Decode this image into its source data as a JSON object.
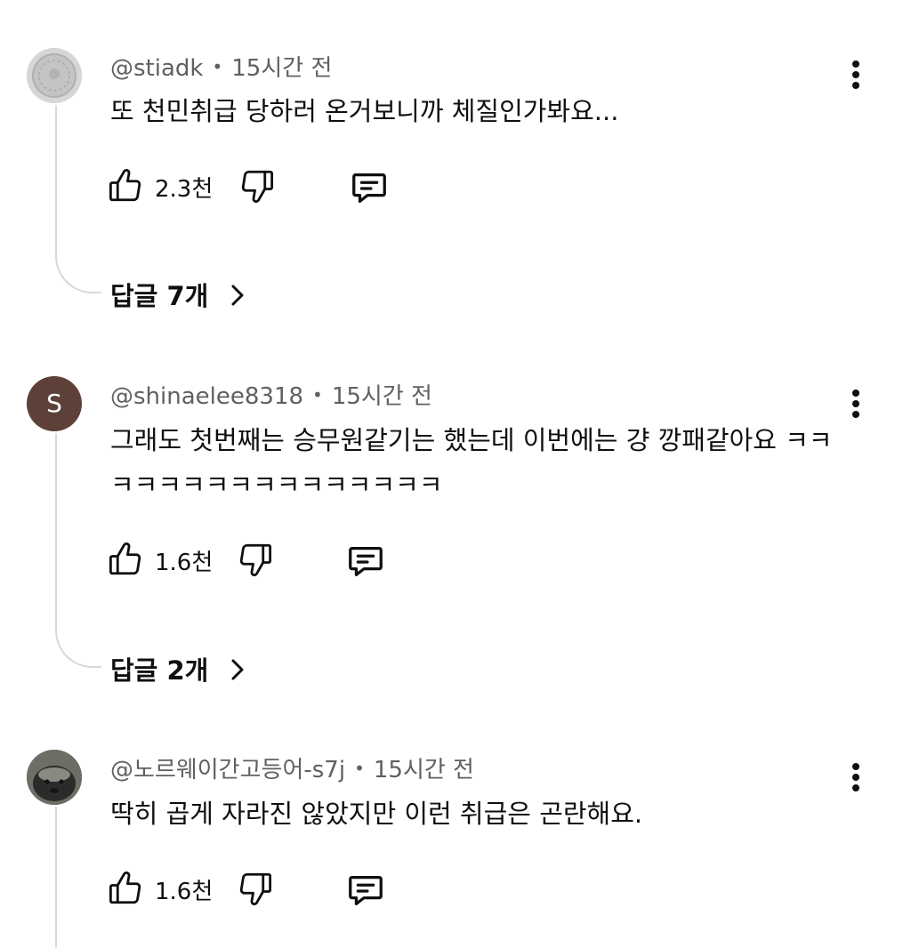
{
  "comments": [
    {
      "author": "@stiadk",
      "time": "15시간 전",
      "text": "또 천민취급 당하러 온거보니까 체질인가봐요...",
      "likes": "2.3천",
      "replies": "답글 7개",
      "avatar": {
        "type": "image",
        "icon": "coin-avatar-icon",
        "color": "#cfcfcf"
      }
    },
    {
      "author": "@shinaelee8318",
      "time": "15시간 전",
      "text": "그래도 첫번째는 승무원같기는 했는데 이번에는 걍 깡패같아요 ㅋㅋㅋㅋㅋㅋㅋㅋㅋㅋㅋㅋㅋㅋㅋㅋ",
      "likes": "1.6천",
      "replies": "답글 2개",
      "avatar": {
        "type": "letter",
        "letter": "S",
        "color": "#5d4037"
      }
    },
    {
      "author": "@노르웨이간고등어-s7j",
      "time": "15시간 전",
      "text": "딱히 곱게 자라진 않았지만 이런 취급은 곤란해요.",
      "likes": "1.6천",
      "replies": "",
      "avatar": {
        "type": "image",
        "icon": "animal-avatar-icon",
        "color": "#3a3a3a"
      }
    }
  ],
  "icons": {
    "like": "thumbs-up-icon",
    "dislike": "thumbs-down-icon",
    "reply": "reply-comment-icon",
    "more": "more-vertical-icon",
    "chevron": "chevron-right-icon"
  },
  "colors": {
    "text": "#0f0f0f",
    "meta": "#606060",
    "thread_line": "#d9d9d9"
  }
}
